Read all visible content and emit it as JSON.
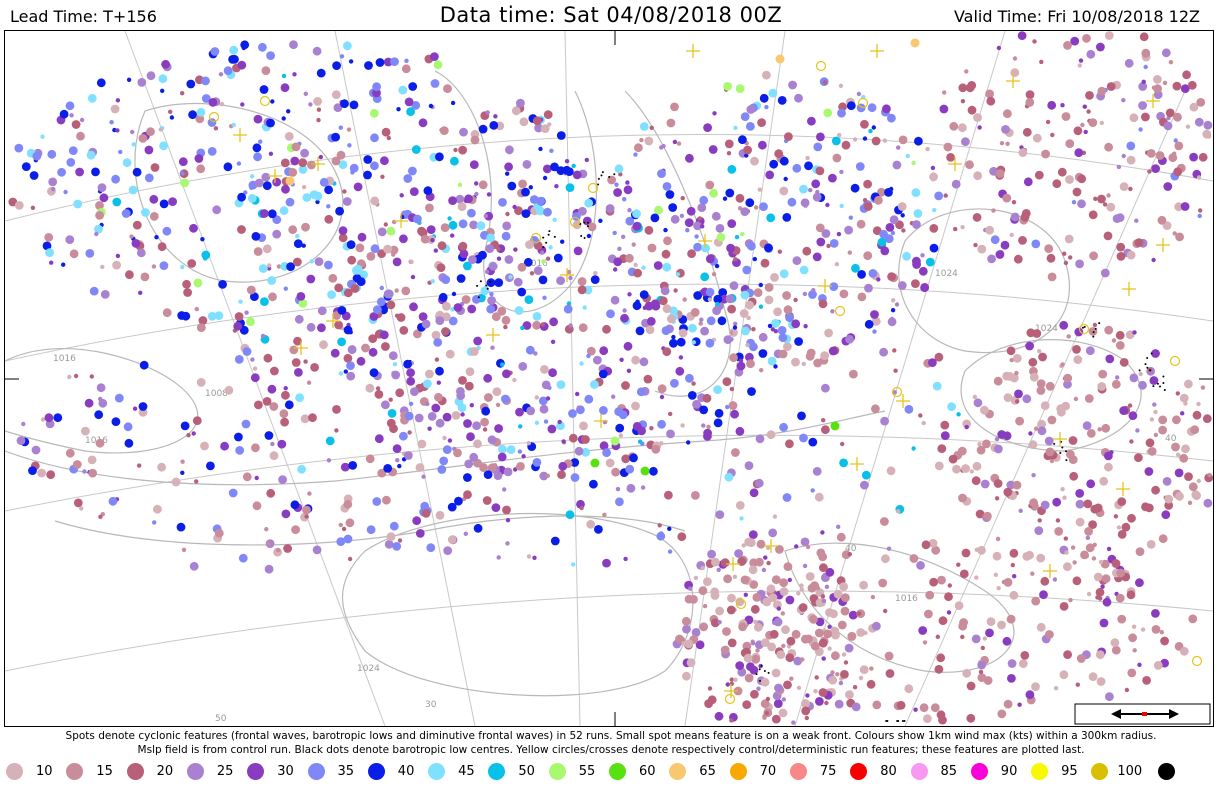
{
  "header": {
    "lead_time": "Lead Time: T+156",
    "data_time": "Data time:  Sat 04/08/2018 00Z",
    "valid_time": "Valid Time: Fri 10/08/2018 12Z"
  },
  "map": {
    "isobar_labels": [
      "1016",
      "1016",
      "1016",
      "1024",
      "1024",
      "1024",
      "1016",
      "1008",
      "30",
      "40",
      "50",
      "40"
    ],
    "background_color": "#ffffff",
    "contour_color": "#b8b8b8",
    "control_marker_color": "#e8c21a"
  },
  "caption": {
    "line1": "Spots denote cyclonic features (frontal waves, barotropic lows and diminutive frontal waves) in 52 runs. Small spot means feature is on a weak front. Colours show 1km wind max (kts) within a 300km radius.",
    "line2": "Mslp field is from control run. Black dots denote barotropic low centres. Yellow circles/crosses denote respectively control/deterministic run features; these features are plotted last."
  },
  "legend": [
    {
      "label": "10",
      "color": "#d6b2b8"
    },
    {
      "label": "15",
      "color": "#c98c9a"
    },
    {
      "label": "20",
      "color": "#b8607a"
    },
    {
      "label": "25",
      "color": "#a882d0"
    },
    {
      "label": "30",
      "color": "#8a3cc0"
    },
    {
      "label": "35",
      "color": "#8088f8"
    },
    {
      "label": "40",
      "color": "#0a1ee8"
    },
    {
      "label": "45",
      "color": "#80e0ff"
    },
    {
      "label": "50",
      "color": "#08c0e8"
    },
    {
      "label": "55",
      "color": "#a8f870"
    },
    {
      "label": "60",
      "color": "#58e010"
    },
    {
      "label": "65",
      "color": "#f8c870"
    },
    {
      "label": "70",
      "color": "#f8a800"
    },
    {
      "label": "75",
      "color": "#f88888"
    },
    {
      "label": "80",
      "color": "#f80000"
    },
    {
      "label": "85",
      "color": "#f898f0"
    },
    {
      "label": "90",
      "color": "#f800d8"
    },
    {
      "label": "95",
      "color": "#f8f800"
    },
    {
      "label": "100",
      "color": "#d8c000"
    },
    {
      "label": "",
      "color": "#000000"
    }
  ]
}
